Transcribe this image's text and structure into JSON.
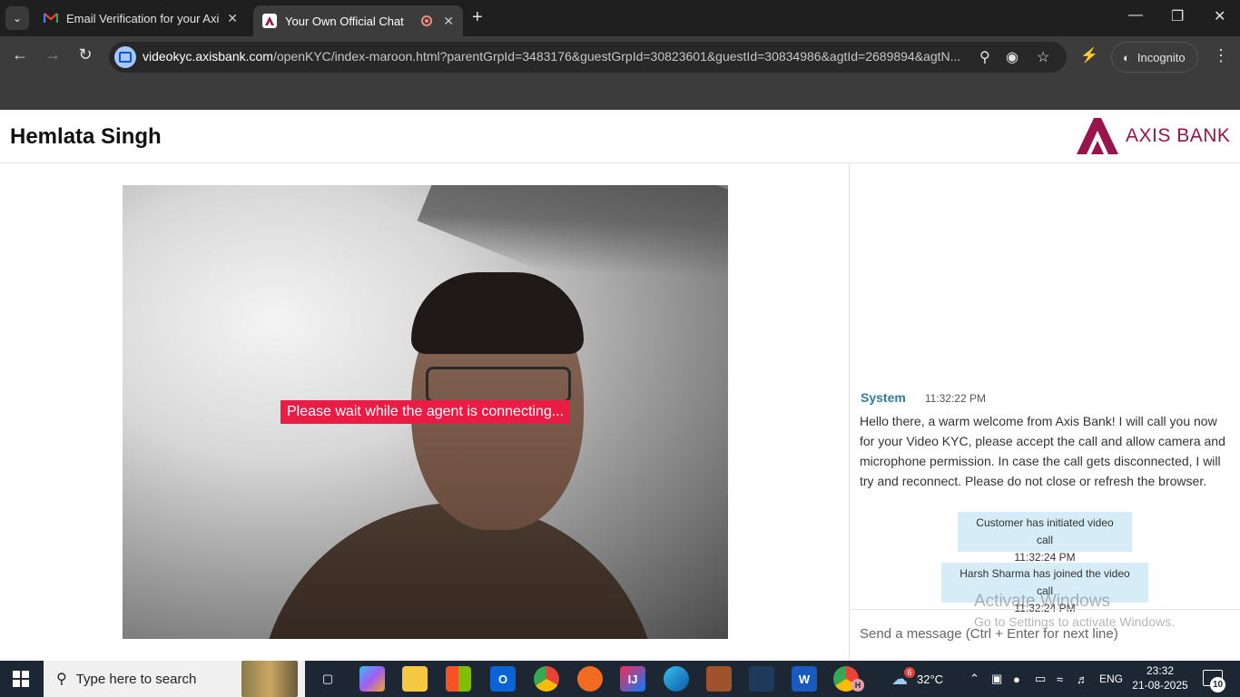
{
  "browser": {
    "tabs": [
      {
        "title": "Email Verification for your Axis Bank",
        "icon": "gmail-icon",
        "active": false
      },
      {
        "title": "Your Own Official Chat",
        "icon": "axis-bank-icon",
        "active": true
      }
    ],
    "url_host": "videokyc.axisbank.com",
    "url_path": "/openKYC/index-maroon.html?parentGrpId=3483176&guestGrpId=30823601&guestId=30834986&agtId=2689894&agtN...",
    "incognito_label": "Incognito"
  },
  "header": {
    "user_name": "Hemlata Singh",
    "logo_text": "AXIS BANK",
    "brand_color": "#97144d"
  },
  "video": {
    "status_message": "Please wait while the agent is connecting..."
  },
  "chat": {
    "messages": [
      {
        "sender": "System",
        "time": "11:32:22 PM",
        "text": "Hello there, a warm welcome from Axis Bank! I will call you now for your Video KYC, please accept the call and allow camera and microphone permission. In case the call gets disconnected, I will try and reconnect. Please do not close or refresh the browser."
      }
    ],
    "notes": [
      {
        "text": "Customer has initiated video call",
        "time": "11:32:24 PM"
      },
      {
        "text": "Harsh Sharma has joined the video call",
        "time": "11:32:24 PM"
      }
    ],
    "input_placeholder": "Send a message (Ctrl + Enter for next line)"
  },
  "watermark": {
    "title": "Activate Windows",
    "subtitle": "Go to Settings to activate Windows."
  },
  "taskbar": {
    "search_placeholder": "Type here to search",
    "weather_temp": "32°C",
    "weather_badge": "6",
    "language": "ENG",
    "time": "23:32",
    "date": "21-08-2025",
    "notification_count": "10",
    "app_badge": "H"
  }
}
